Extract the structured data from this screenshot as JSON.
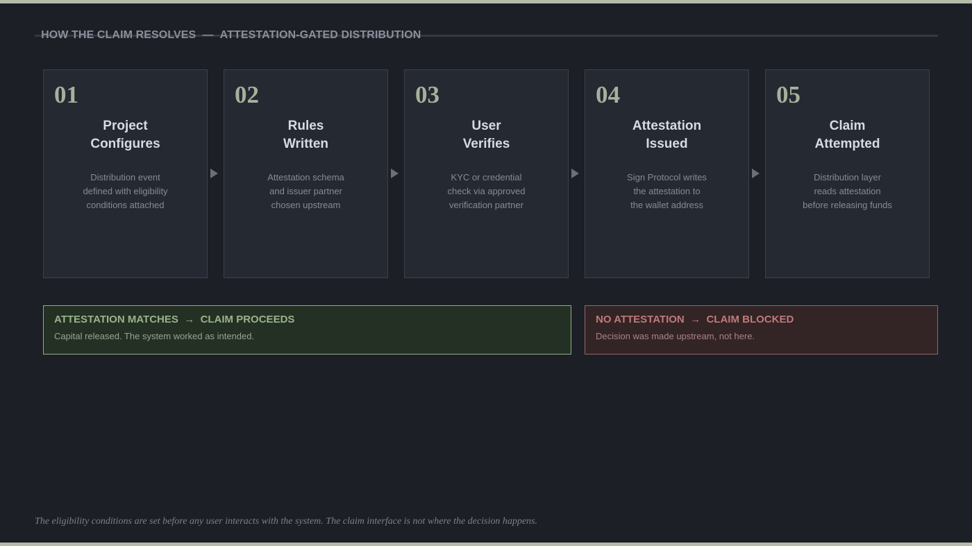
{
  "header": {
    "left": "HOW THE CLAIM RESOLVES",
    "separator": "—",
    "right": "ATTESTATION-GATED DISTRIBUTION"
  },
  "steps": [
    {
      "number": "01",
      "title": [
        "Project",
        "Configures"
      ],
      "description": [
        "Distribution event",
        "defined with eligibility",
        "conditions attached"
      ]
    },
    {
      "number": "02",
      "title": [
        "Rules",
        "Written"
      ],
      "description": [
        "Attestation schema",
        "and issuer partner",
        "chosen upstream"
      ]
    },
    {
      "number": "03",
      "title": [
        "User",
        "Verifies"
      ],
      "description": [
        "KYC or credential",
        "check via approved",
        "verification partner"
      ]
    },
    {
      "number": "04",
      "title": [
        "Attestation",
        "Issued"
      ],
      "description": [
        "Sign Protocol writes",
        "the attestation to",
        "the wallet address"
      ]
    },
    {
      "number": "05",
      "title": [
        "Claim",
        "Attempted"
      ],
      "description": [
        "Distribution layer",
        "reads attestation",
        "before releasing funds"
      ]
    }
  ],
  "outcomes": {
    "pass": {
      "condition": "ATTESTATION MATCHES",
      "arrow": "→",
      "result": "CLAIM PROCEEDS",
      "detail": "Capital released. The system worked as intended."
    },
    "fail": {
      "condition": "NO ATTESTATION",
      "arrow": "→",
      "result": "CLAIM BLOCKED",
      "detail": "Decision was made upstream, not here."
    }
  },
  "footnote": "The eligibility conditions are set before any user interacts with the system. The claim interface is not where the decision happens.",
  "colors": {
    "background": "#1c1f26",
    "accent": "#b3bca6",
    "pass": "#98b48c",
    "fail": "#c07a7b"
  }
}
